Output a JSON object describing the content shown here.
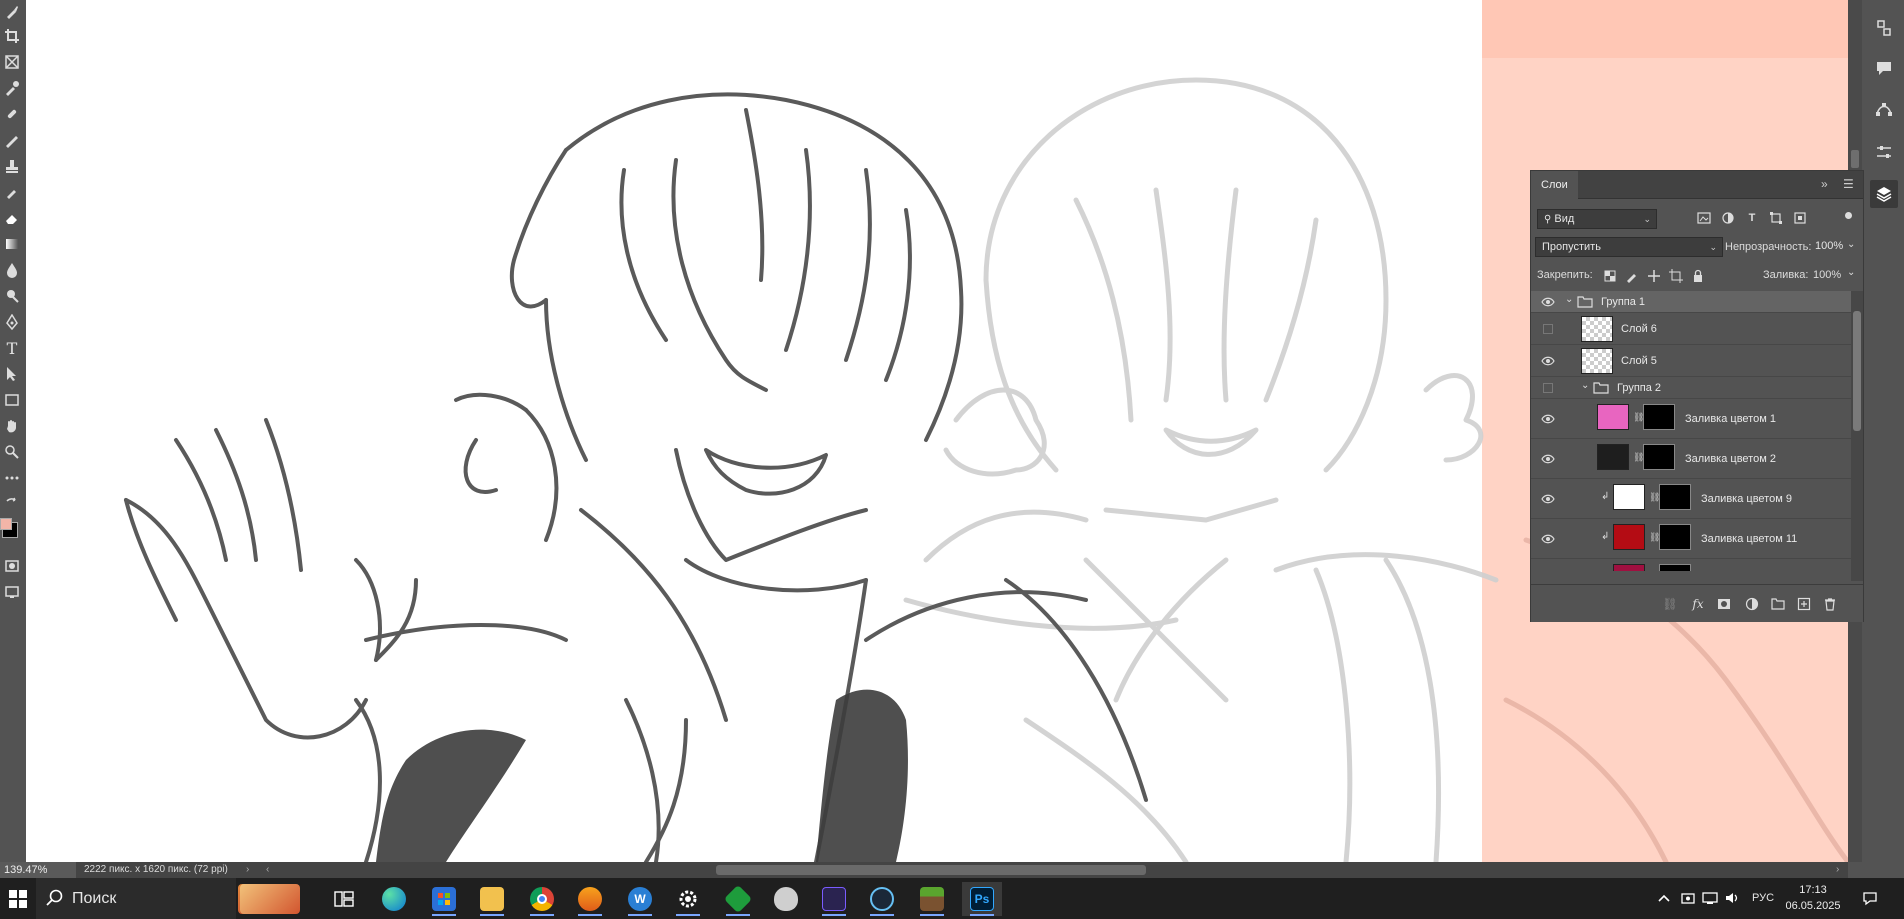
{
  "canvas": {
    "backdrop_color": "#ffd3c5",
    "backdrop_band_color": "#ffc7b5"
  },
  "layers_panel": {
    "tab_label": "Слои",
    "filter_label": "Вид",
    "blend_mode": "Пропустить",
    "opacity_label": "Непрозрачность:",
    "opacity_value": "100%",
    "lock_label": "Закрепить:",
    "fill_label": "Заливка:",
    "fill_value": "100%",
    "layers": [
      {
        "name": "Группа 1",
        "type": "group",
        "visible": true,
        "selected": true
      },
      {
        "name": "Слой 6",
        "type": "layer",
        "visible": false
      },
      {
        "name": "Слой 5",
        "type": "layer",
        "visible": true
      },
      {
        "name": "Группа 2",
        "type": "group",
        "visible": false
      },
      {
        "name": "Заливка цветом 1",
        "type": "fill",
        "visible": true,
        "color": "#e865c0"
      },
      {
        "name": "Заливка цветом 2",
        "type": "fill",
        "visible": true,
        "color": "#1e1e1e"
      },
      {
        "name": "Заливка цветом 9",
        "type": "fill",
        "visible": true,
        "color": "#ffffff",
        "clipped": true
      },
      {
        "name": "Заливка цветом 11",
        "type": "fill",
        "visible": true,
        "color": "#b40c14",
        "clipped": true
      },
      {
        "name": "",
        "type": "fill",
        "visible": true,
        "color": "#a01040",
        "clipped": true
      }
    ]
  },
  "status_bar": {
    "zoom": "139.47%",
    "doc_info": "2222 пикс. x 1620 пикс. (72 ppi)"
  },
  "colors": {
    "foreground": "#f2b5a8",
    "background": "#000000"
  },
  "taskbar": {
    "search_placeholder": "Поиск",
    "language": "РУС",
    "time": "17:13",
    "date": "06.05.2025",
    "apps": [
      {
        "name": "task-view",
        "label": ""
      },
      {
        "name": "edge",
        "label": ""
      },
      {
        "name": "store",
        "label": ""
      },
      {
        "name": "explorer",
        "label": ""
      },
      {
        "name": "chrome",
        "label": ""
      },
      {
        "name": "fl-studio",
        "label": ""
      },
      {
        "name": "w-app",
        "label": "W"
      },
      {
        "name": "settings",
        "label": ""
      },
      {
        "name": "green-app",
        "label": ""
      },
      {
        "name": "mask-app",
        "label": ""
      },
      {
        "name": "capture-app",
        "label": ""
      },
      {
        "name": "steam",
        "label": ""
      },
      {
        "name": "minecraft",
        "label": ""
      },
      {
        "name": "photoshop",
        "label": "Ps"
      }
    ]
  }
}
